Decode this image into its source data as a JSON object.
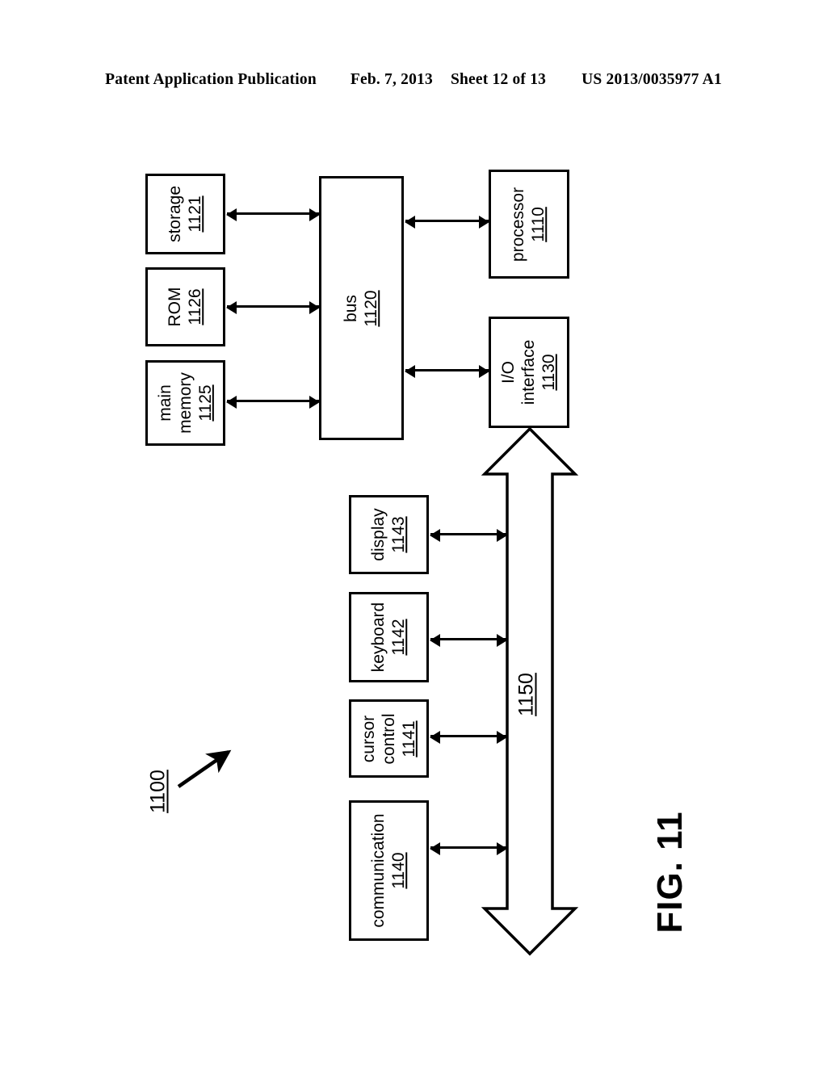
{
  "header": {
    "publication": "Patent Application Publication",
    "date": "Feb. 7, 2013",
    "sheet": "Sheet 12 of 13",
    "patent_number": "US 2013/0035977 A1"
  },
  "figure": {
    "caption": "FIG. 11",
    "system_ref": "1100",
    "io_bus_ref": "1150"
  },
  "blocks": {
    "storage": {
      "name": "storage",
      "ref": "1121"
    },
    "rom": {
      "name": "ROM",
      "ref": "1126"
    },
    "main_memory": {
      "name": "main\nmemory",
      "ref": "1125"
    },
    "bus": {
      "name": "bus",
      "ref": "1120"
    },
    "processor": {
      "name": "processor",
      "ref": "1110"
    },
    "io_interface": {
      "name": "I/O\ninterface",
      "ref": "1130"
    },
    "display": {
      "name": "display",
      "ref": "1143"
    },
    "keyboard": {
      "name": "keyboard",
      "ref": "1142"
    },
    "cursor_control": {
      "name": "cursor\ncontrol",
      "ref": "1141"
    },
    "communication": {
      "name": "communication",
      "ref": "1140"
    }
  },
  "colors": {
    "stroke": "#000000",
    "background": "#ffffff"
  }
}
